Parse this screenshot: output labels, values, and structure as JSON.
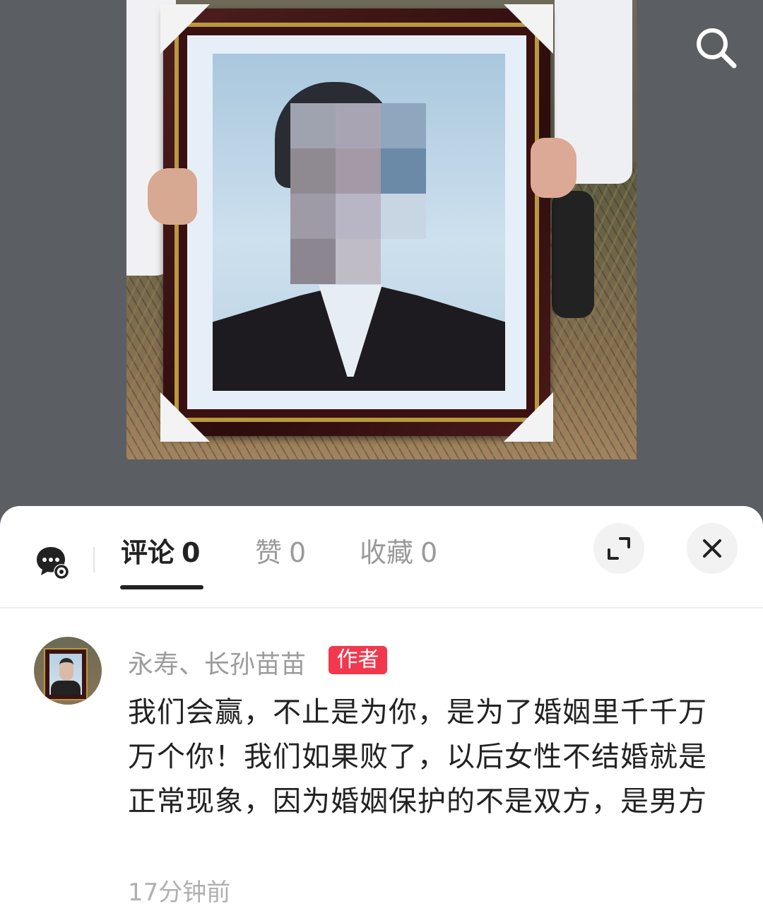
{
  "sheet": {
    "tabs": [
      {
        "label": "评论",
        "count": "0"
      },
      {
        "label": "赞",
        "count": "0"
      },
      {
        "label": "收藏",
        "count": "0"
      }
    ]
  },
  "comment": {
    "username": "永寿、长孙苗苗",
    "badge": "作者",
    "text": "我们会赢，不止是为你，是为了婚姻里千千万万个你！我们如果败了，以后女性不结婚就是正常现象，因为婚姻保护的不是双方，是男方",
    "time": "17分钟前"
  },
  "colors": {
    "badge": "#f2384e",
    "active_tab": "#222222",
    "inactive_tab": "#9a9a9a"
  }
}
